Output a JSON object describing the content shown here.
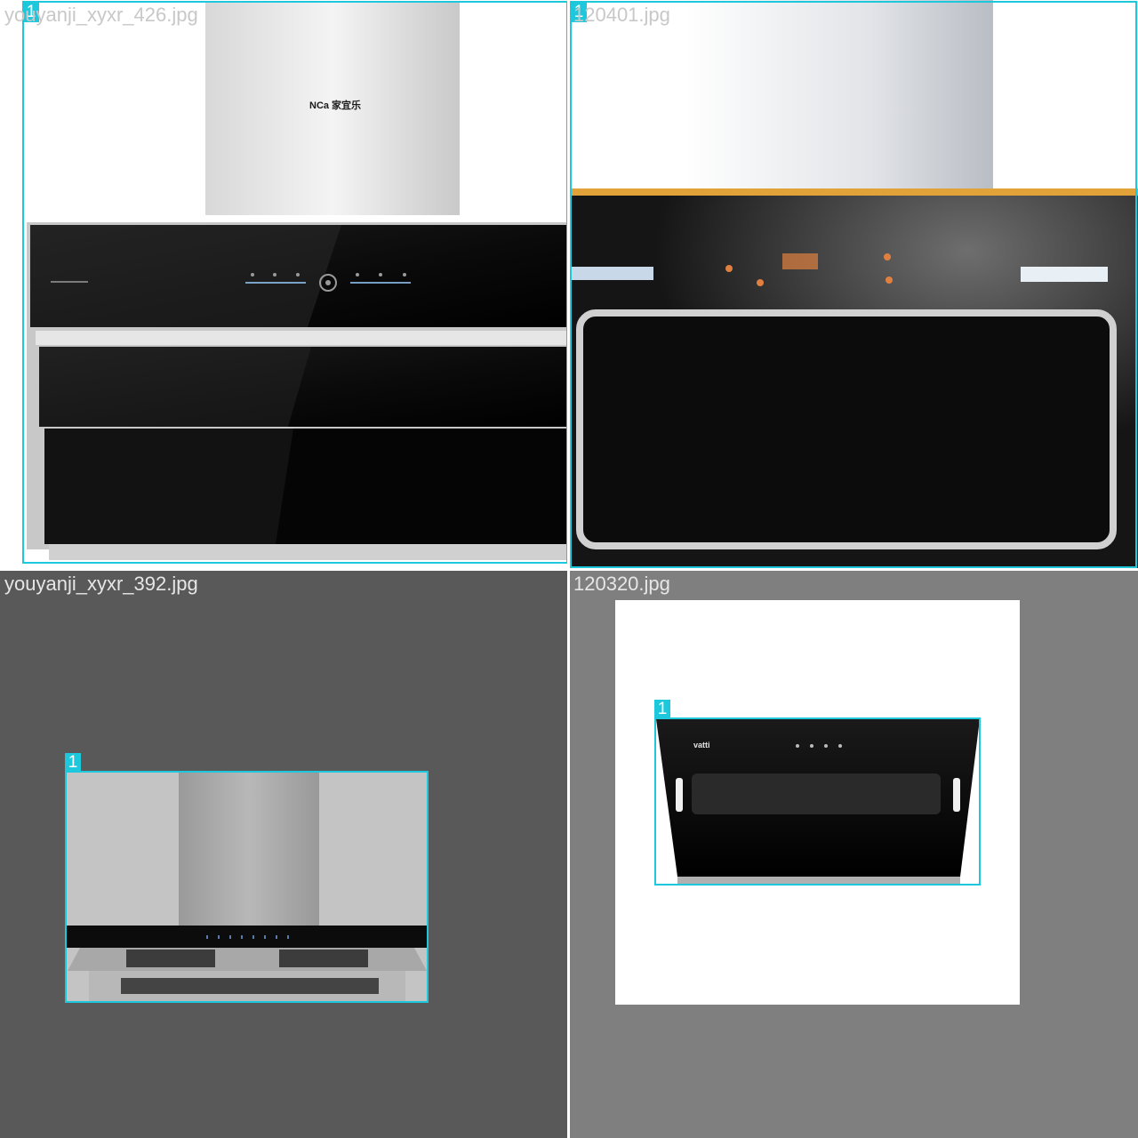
{
  "tiles": [
    {
      "filename": "youyanji_xyxr_426.jpg",
      "box_label": "1",
      "logo_text": "NCa 家宜乐"
    },
    {
      "filename": "120401.jpg",
      "box_label": "1"
    },
    {
      "filename": "youyanji_xyxr_392.jpg",
      "box_label": "1"
    },
    {
      "filename": "120320.jpg",
      "box_label": "1",
      "brand_text": "vatti"
    }
  ],
  "colors": {
    "bbox": "#1ec8dc",
    "tile3_bg": "#595959",
    "tile4_bg": "#7f7f7f"
  }
}
